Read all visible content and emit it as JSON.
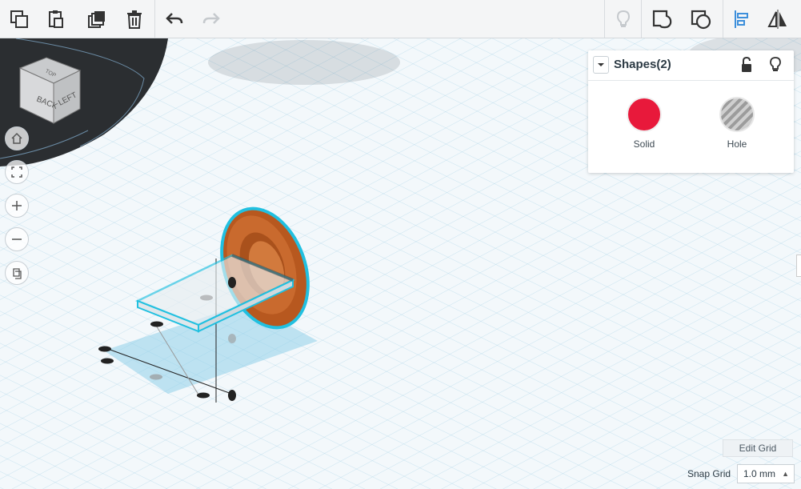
{
  "toolbar": {
    "left": [
      {
        "name": "copy-icon"
      },
      {
        "name": "paste-icon"
      },
      {
        "name": "duplicate-icon"
      },
      {
        "name": "delete-icon"
      },
      {
        "name": "undo-icon"
      },
      {
        "name": "redo-icon"
      }
    ],
    "right": [
      {
        "name": "light-bulb-icon"
      },
      {
        "name": "group-icon"
      },
      {
        "name": "ungroup-icon"
      },
      {
        "name": "align-icon"
      },
      {
        "name": "mirror-icon"
      }
    ]
  },
  "viewcube": {
    "back": "BACK",
    "left": "LEFT",
    "top": "TOP"
  },
  "nav": [
    "home-icon",
    "fit-view-icon",
    "zoom-in-icon",
    "zoom-out-icon",
    "perspective-icon"
  ],
  "shape_panel": {
    "title": "Shapes(2)",
    "solid_label": "Solid",
    "hole_label": "Hole",
    "solid_color": "#e8193b",
    "hole_color": "#b5b5b5"
  },
  "grid": {
    "edit_label": "Edit Grid",
    "snap_label": "Snap Grid",
    "snap_value": "1.0 mm"
  },
  "colors": {
    "grid_line": "#9fd0e6",
    "selection": "#21c0e0",
    "part": "#c0622a"
  }
}
